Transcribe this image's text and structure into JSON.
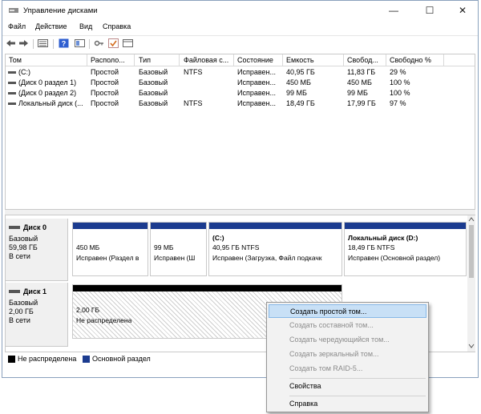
{
  "window": {
    "title": "Управление дисками",
    "min_glyph": "—",
    "max_glyph": "☐",
    "close_glyph": "✕"
  },
  "menu": [
    "Файл",
    "Действие",
    "Вид",
    "Справка"
  ],
  "toolbar_icons": [
    "back-icon",
    "forward-icon",
    "list-view-icon",
    "help-icon",
    "properties-icon",
    "key-icon",
    "check-icon",
    "panel-icon"
  ],
  "columns": [
    "Том",
    "Располо...",
    "Тип",
    "Файловая с...",
    "Состояние",
    "Емкость",
    "Свобод...",
    "Свободно %"
  ],
  "volumes": [
    {
      "name": "(C:)",
      "layout": "Простой",
      "type": "Базовый",
      "fs": "NTFS",
      "status": "Исправен...",
      "capacity": "40,95 ГБ",
      "free": "11,83 ГБ",
      "free_pct": "29 %"
    },
    {
      "name": "(Диск 0 раздел 1)",
      "layout": "Простой",
      "type": "Базовый",
      "fs": "",
      "status": "Исправен...",
      "capacity": "450 МБ",
      "free": "450 МБ",
      "free_pct": "100 %"
    },
    {
      "name": "(Диск 0 раздел 2)",
      "layout": "Простой",
      "type": "Базовый",
      "fs": "",
      "status": "Исправен...",
      "capacity": "99 МБ",
      "free": "99 МБ",
      "free_pct": "100 %"
    },
    {
      "name": "Локальный диск (...",
      "layout": "Простой",
      "type": "Базовый",
      "fs": "NTFS",
      "status": "Исправен...",
      "capacity": "18,49 ГБ",
      "free": "17,99 ГБ",
      "free_pct": "97 %"
    }
  ],
  "disks": [
    {
      "title": "Диск 0",
      "kind": "Базовый",
      "size": "59,98 ГБ",
      "state": "В сети",
      "partitions": [
        {
          "name": "",
          "line1": "450 МБ",
          "line2": "Исправен (Раздел в"
        },
        {
          "name": "",
          "line1": "99 МБ",
          "line2": "Исправен (Ш"
        },
        {
          "name": "(C:)",
          "line1": "40,95 ГБ NTFS",
          "line2": "Исправен (Загрузка, Файл подкачк"
        },
        {
          "name": "Локальный диск  (D:)",
          "line1": "18,49 ГБ NTFS",
          "line2": "Исправен (Основной раздел)"
        }
      ]
    },
    {
      "title": "Диск 1",
      "kind": "Базовый",
      "size": "2,00 ГБ",
      "state": "В сети",
      "partitions": [
        {
          "name": "",
          "line1": "2,00 ГБ",
          "line2": "Не распределена"
        }
      ]
    }
  ],
  "legend": [
    {
      "label": "Не распределена",
      "color": "#000000"
    },
    {
      "label": "Основной раздел",
      "color": "#1b3b8f"
    }
  ],
  "context_menu": {
    "items": [
      {
        "label": "Создать простой том...",
        "state": "highlighted"
      },
      {
        "label": "Создать составной том...",
        "state": "disabled"
      },
      {
        "label": "Создать чередующийся том...",
        "state": "disabled"
      },
      {
        "label": "Создать зеркальный том...",
        "state": "disabled"
      },
      {
        "label": "Создать том RAID-5...",
        "state": "disabled"
      }
    ],
    "properties": "Свойства",
    "help": "Справка"
  },
  "colors": {
    "primary_partition": "#1b3b8f",
    "unallocated": "#000000",
    "highlight": "#c8e0f6"
  }
}
